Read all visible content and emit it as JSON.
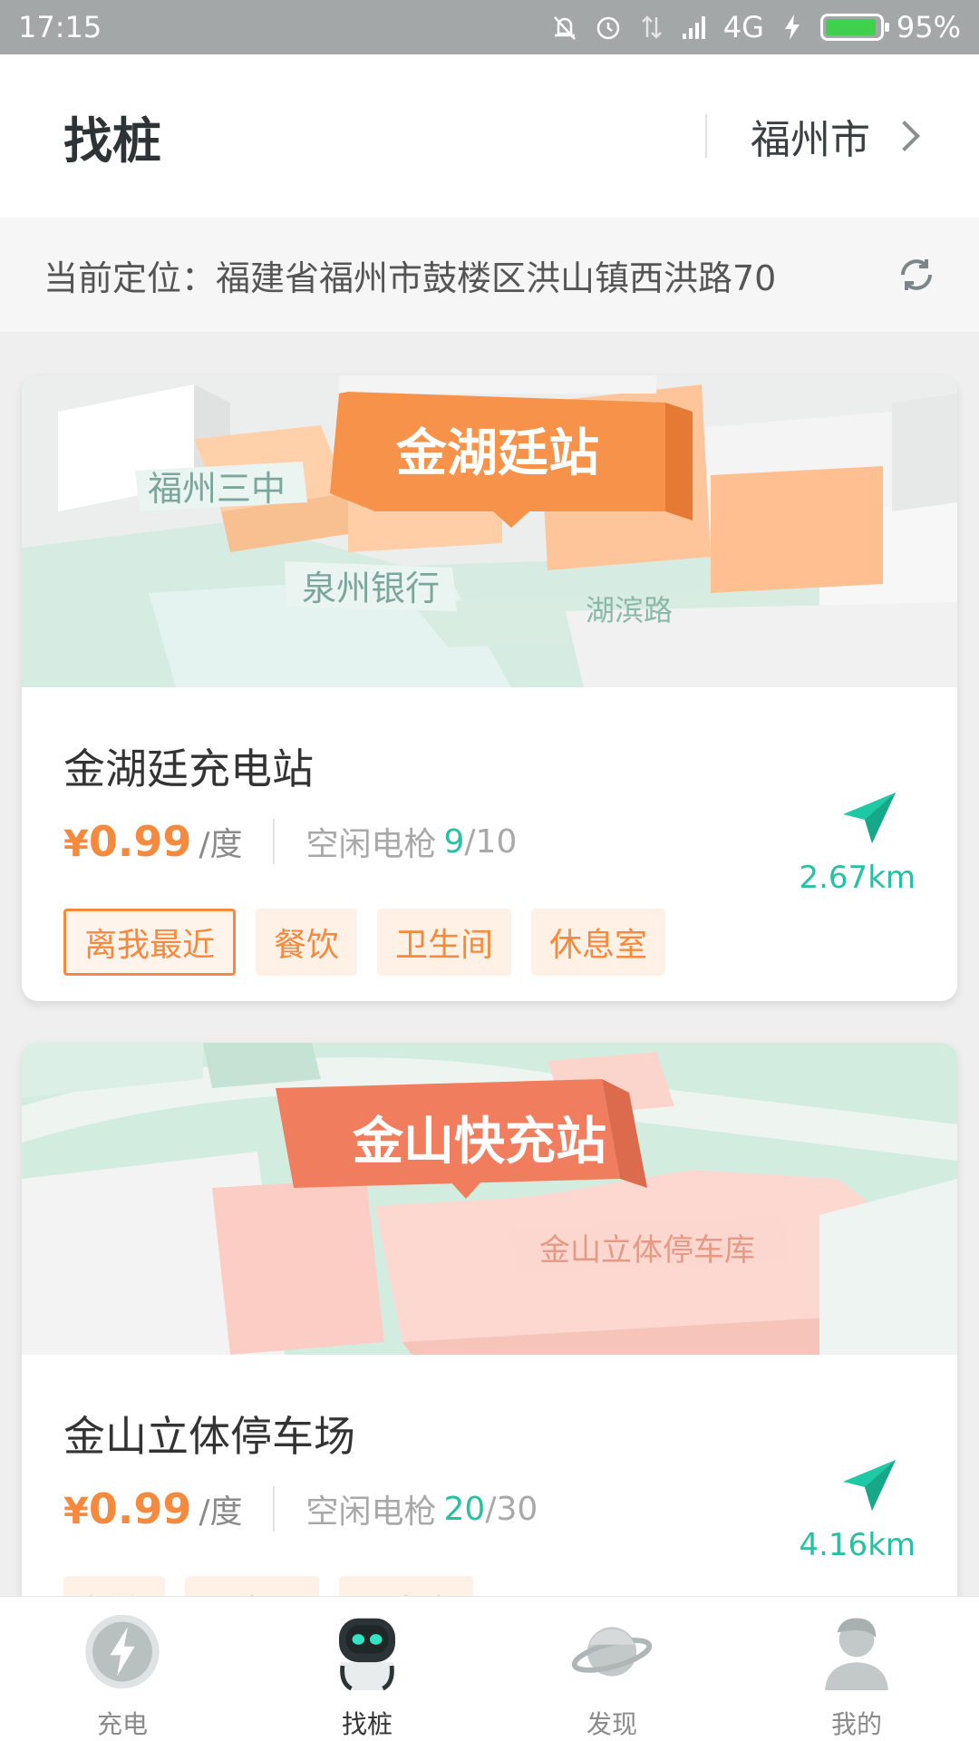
{
  "status_bar": {
    "time": "17:15",
    "network": "4G",
    "battery": "95%",
    "battery_level": 0.95,
    "icons": [
      "mute-icon",
      "alarm-icon",
      "data-arrows-icon",
      "signal-icon",
      "charging-icon",
      "battery-icon"
    ]
  },
  "header": {
    "title": "找桩",
    "city": "福州市"
  },
  "location": {
    "text": "当前定位：福建省福州市鼓楼区洪山镇西洪路70"
  },
  "stations": [
    {
      "map_title": "金湖廷站",
      "map_labels": [
        "福州三中",
        "泉州银行",
        "湖滨路"
      ],
      "name": "金湖廷充电站",
      "price_symbol": "¥",
      "price": "0.99",
      "unit": "/度",
      "idle_label": "空闲电枪",
      "idle_free": "9",
      "idle_total": "/10",
      "distance": "2.67km",
      "tags": [
        "离我最近",
        "餐饮",
        "卫生间",
        "休息室"
      ]
    },
    {
      "map_title": "金山快充站",
      "map_labels": [
        "金山立体停车库"
      ],
      "name": "金山立体停车场",
      "price_symbol": "¥",
      "price": "0.99",
      "unit": "/度",
      "idle_label": "空闲电枪",
      "idle_free": "20",
      "idle_total": "/30",
      "distance": "4.16km",
      "tags": [
        "餐饮",
        "卫生间",
        "休息室"
      ]
    }
  ],
  "bottom_nav": [
    {
      "label": "充电",
      "icon": "lightning-icon"
    },
    {
      "label": "找桩",
      "icon": "robot-icon",
      "active": true
    },
    {
      "label": "发现",
      "icon": "planet-icon"
    },
    {
      "label": "我的",
      "icon": "user-icon"
    }
  ],
  "colors": {
    "accent_orange": "#f58a3e",
    "accent_green": "#29c0a2",
    "status_bar": "#a3a7a8"
  }
}
